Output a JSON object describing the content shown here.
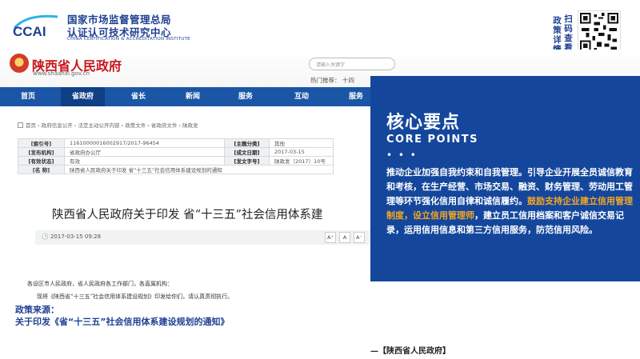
{
  "header": {
    "logo_text": "CCAI",
    "org_title": "国家市场监督管理总局",
    "org_subtitle": "认证认可技术研究中心",
    "org_english": "CHINA CERTIFICATION & ACCREDITATION INSTITUTE",
    "scan_col1": "政策详情",
    "scan_col2": "扫码查看"
  },
  "screenshot": {
    "site_name": "陕西省人民政府",
    "site_url": "www.shaanxi.gov.cn",
    "search_placeholder": "请输入关键字",
    "hot_words": "热门推荐：    十四",
    "nav": [
      "首页",
      "省政府",
      "省长",
      "新闻",
      "服务",
      "互动",
      "服务"
    ],
    "breadcrumb": "首页 › 政府信息公开 › 法定主动公开内容 › 政策文件 › 省政府文件 › 陕政发",
    "meta": [
      {
        "k": "[索引号]",
        "v": "11610000016002917/2017-96454",
        "k2": "[主题分类]",
        "v2": "其他"
      },
      {
        "k": "[发布机构]",
        "v": "省政府办公厅",
        "k2": "[成文日期]",
        "v2": "2017-03-15"
      },
      {
        "k": "[有效状态]",
        "v": "有效",
        "k2": "[发文字号]",
        "v2": "陕政发〔2017〕10号"
      },
      {
        "k": "[名  称]",
        "v": "陕西省人民政府关于印发 省“十三五”社会信用体系建设规划的通知",
        "k2": "",
        "v2": ""
      }
    ],
    "doc_title": "陕西省人民政府关于印发 省“十三五”社会信用体系建",
    "publish_date": "2017-03-15 09:28",
    "font_btns": [
      "A⁺",
      "A",
      "A⁻"
    ],
    "body_lines": [
      "各设区市人民政府，省人民政府各工作部门，各直属机构：",
      "现将《陕西省“十三五”社会信用体系建设规划》印发给你们，请认真贯彻执行。"
    ]
  },
  "core": {
    "title": "核心要点",
    "title_en": "CORE POINTS",
    "dots": "• • •",
    "text_before": "推动企业加强自我约束和自我管理。引导企业开展全员诚信教育和考核，在生产经营、市场交易、融资、财务管理、劳动用工管理等环节强化信用自律和诚信履约。",
    "text_highlight": "鼓励支持企业建立信用管理制度，设立信用管理师",
    "text_after": "，建立员工信用档案和客户诚信交易记录，运用信用信息和第三方信用服务，防范信用风险。"
  },
  "footer": {
    "source_label": "政策来源：",
    "source_title": "关于印发《省“十三五”社会信用体系建设规划的通知》",
    "source_org": "—【陕西省人民政府】"
  },
  "colors": {
    "brand_blue": "#1f3f92",
    "panel_blue": "#14479c",
    "highlight_orange": "#f5a623",
    "gov_red": "#c8161d"
  }
}
